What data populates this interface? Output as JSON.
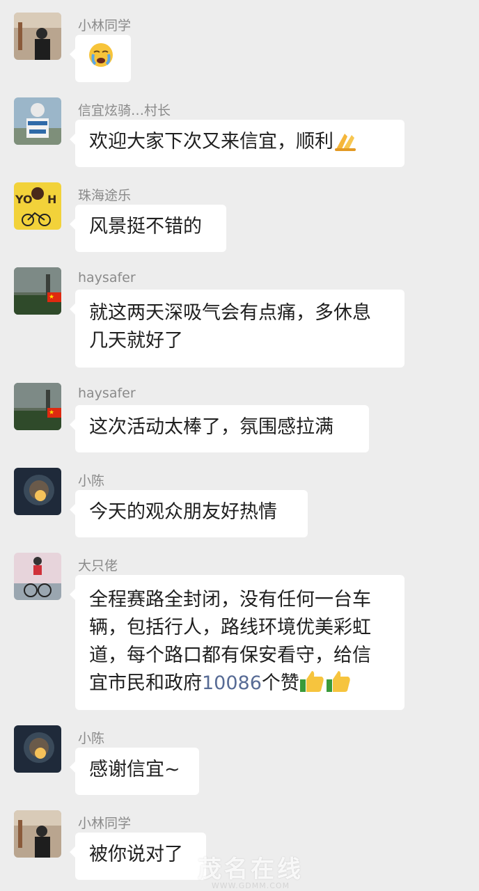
{
  "messages": [
    {
      "name": "小林同学",
      "text": "",
      "emoji": "crying-face-emoji"
    },
    {
      "name": "信宜炫骑…村长",
      "text": "欢迎大家下次又来信宜，顺利",
      "emoji": "pray-hands-emoji"
    },
    {
      "name": "珠海途乐",
      "text": "风景挺不错的"
    },
    {
      "name": "haysafer",
      "line1": "就这两天深吸气会有点痛，多休息",
      "line2": "几天就好了"
    },
    {
      "name": "haysafer",
      "text": "这次活动太棒了，氛围感拉满"
    },
    {
      "name": "小陈",
      "text": "今天的观众朋友好热情"
    },
    {
      "name": "大只佬",
      "line1": "全程赛路全封闭，没有任何一台车",
      "line2": "辆，包括行人，路线环境优美彩虹",
      "line3": "道，每个路口都有保安看守，给信",
      "line4_pre": "宜市民和政府",
      "line4_num": "10086",
      "line4_post": "个赞",
      "emoji": "thumbs-up-emoji"
    },
    {
      "name": "小陈",
      "text": "感谢信宜~"
    },
    {
      "name": "小林同学",
      "text": "被你说对了"
    }
  ],
  "watermark": {
    "brand": "茂名在线",
    "url": "WWW.GDMM.COM"
  },
  "colors": {
    "background": "#ededed",
    "bubble": "#ffffff",
    "name": "#8a8a8a",
    "link_number": "#576b95"
  }
}
